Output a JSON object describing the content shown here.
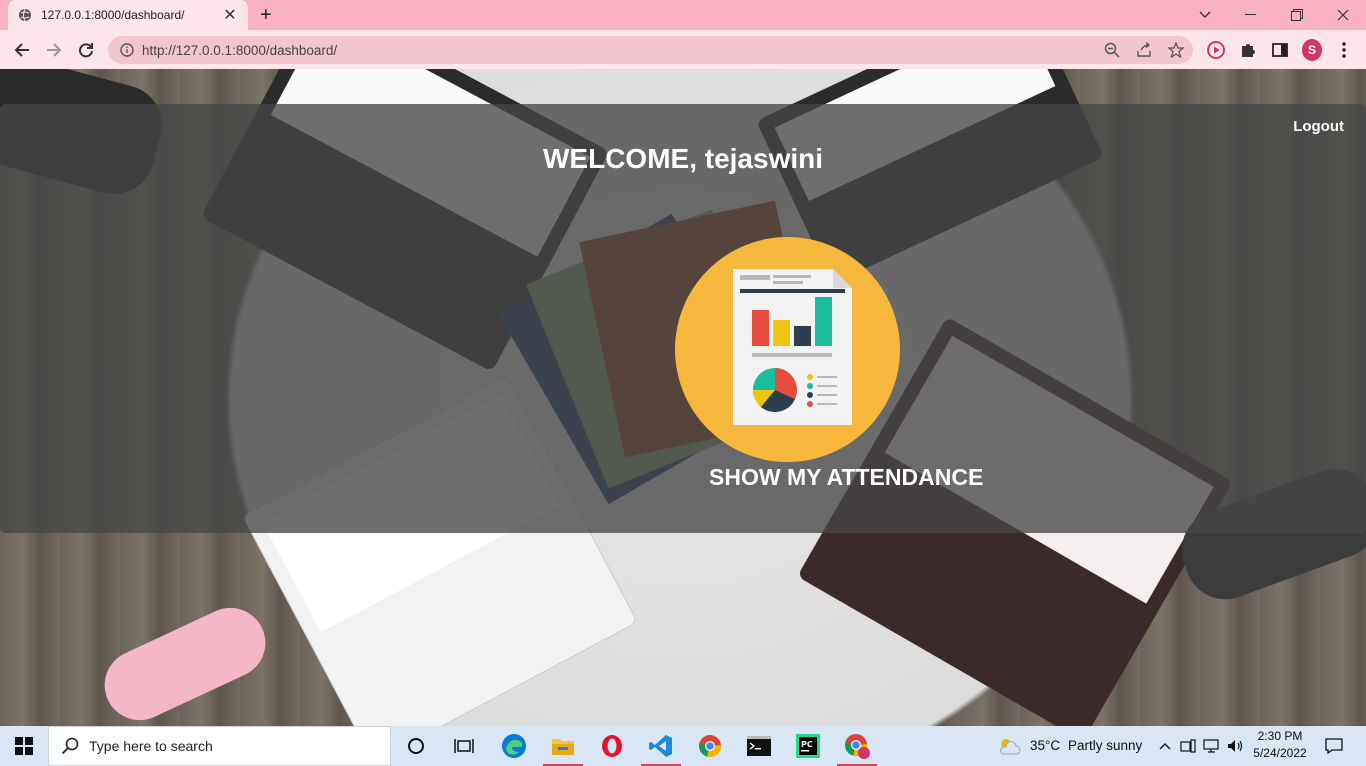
{
  "browser": {
    "tab_title": "127.0.0.1:8000/dashboard/",
    "url": "http://127.0.0.1:8000/dashboard/",
    "profile_initial": "S"
  },
  "page": {
    "logout_label": "Logout",
    "welcome_text": "WELCOME, tejaswini",
    "attendance_label": "SHOW MY ATTENDANCE"
  },
  "taskbar": {
    "search_placeholder": "Type here to search",
    "weather_temp": "35°C",
    "weather_desc": "Partly sunny",
    "time": "2:30 PM",
    "date": "5/24/2022"
  },
  "colors": {
    "tab_strip": "#f9b2c1",
    "toolbar": "#fde6eb",
    "overlay": "#464646",
    "attendance_circle": "#f6b73c",
    "taskbar": "#d9e6f3"
  }
}
